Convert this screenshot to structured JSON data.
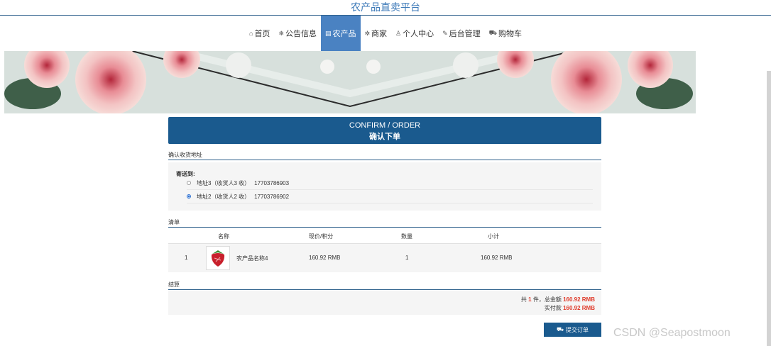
{
  "site": {
    "title": "农产品直卖平台"
  },
  "nav": [
    {
      "icon": "home-icon",
      "glyph": "⌂",
      "label": "首页",
      "active": false
    },
    {
      "icon": "notice-icon",
      "glyph": "❄",
      "label": "公告信息",
      "active": false
    },
    {
      "icon": "product-icon",
      "glyph": "▤",
      "label": "农产品",
      "active": true
    },
    {
      "icon": "merchant-icon",
      "glyph": "✲",
      "label": "商家",
      "active": false
    },
    {
      "icon": "user-icon",
      "glyph": "♙",
      "label": "个人中心",
      "active": false
    },
    {
      "icon": "admin-icon",
      "glyph": "✎",
      "label": "后台管理",
      "active": false
    },
    {
      "icon": "cart-icon",
      "glyph": "⛟",
      "label": "购物车",
      "active": false
    }
  ],
  "confirm": {
    "line1": "CONFIRM / ORDER",
    "line2": "确认下单"
  },
  "address": {
    "section_label": "确认收货地址",
    "title": "寄送到:",
    "options": [
      {
        "label": "地址3（收货人3 收）",
        "phone": "17703786903",
        "selected": false
      },
      {
        "label": "地址2（收货人2 收）",
        "phone": "17703786902",
        "selected": true
      }
    ]
  },
  "order": {
    "section_label": "清单",
    "headers": [
      "名称",
      "现价/积分",
      "数量",
      "小计"
    ],
    "rows": [
      {
        "index": "1",
        "name": "农产品名称4",
        "price": "160.92 RMB",
        "qty": "1",
        "subtotal": "160.92 RMB"
      }
    ]
  },
  "settle": {
    "section_label": "结算",
    "count_prefix": "共",
    "count": "1",
    "count_suffix": "件，总金额",
    "total": "160.92 RMB",
    "pay_label": "实付款",
    "pay": "160.92 RMB"
  },
  "submit": {
    "icon": "cart-icon",
    "label": "提交订单"
  },
  "watermark": "CSDN @Seapostmoon"
}
